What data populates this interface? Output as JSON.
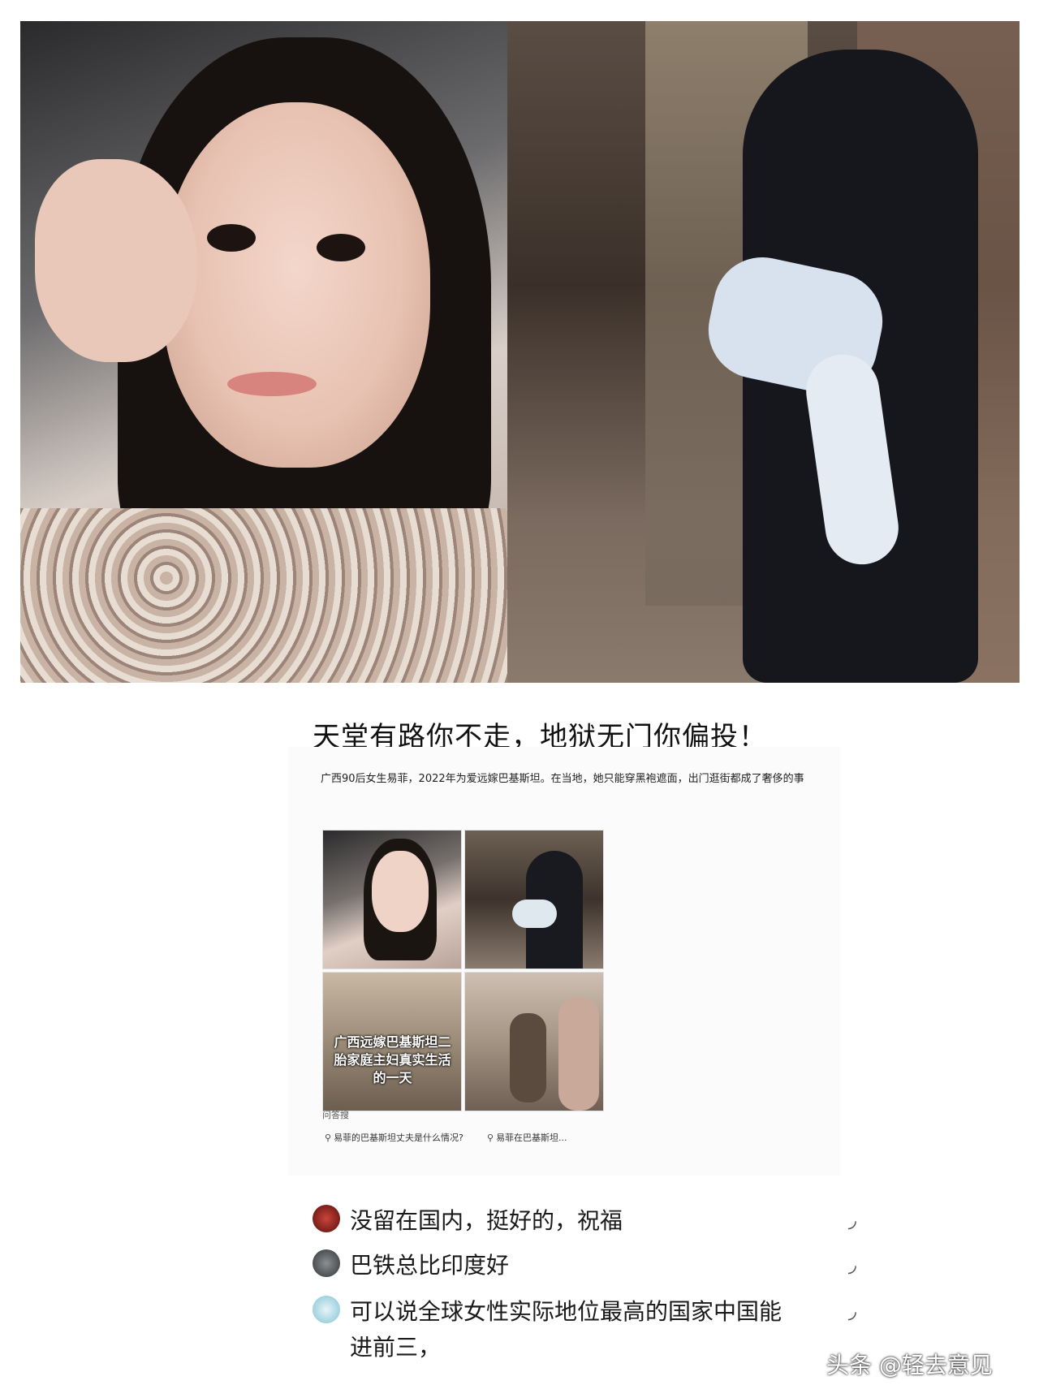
{
  "title": "天堂有路你不走，地狱无门你偏投！",
  "card": {
    "text": "广西90后女生易菲，2022年为爱远嫁巴基斯坦。在当地，她只能穿黑袍遮面，出门逛街都成了奢侈的事",
    "thumb_caption": "广西远嫁巴基斯坦二胎家庭主妇真实生活的一天",
    "ask_label": "问答搜",
    "search_suggestions": [
      "易菲的巴基斯坦丈夫是什么情况?",
      "易菲在巴基斯坦..."
    ]
  },
  "comments": [
    {
      "text": "没留在国内，挺好的，祝福"
    },
    {
      "text": "巴铁总比印度好"
    },
    {
      "text": "可以说全球女性实际地位最高的国家中国能进前三，"
    }
  ],
  "icons": {
    "reply": "reply-icon",
    "search": "search-icon"
  },
  "watermark": "头条 @轻去意见"
}
